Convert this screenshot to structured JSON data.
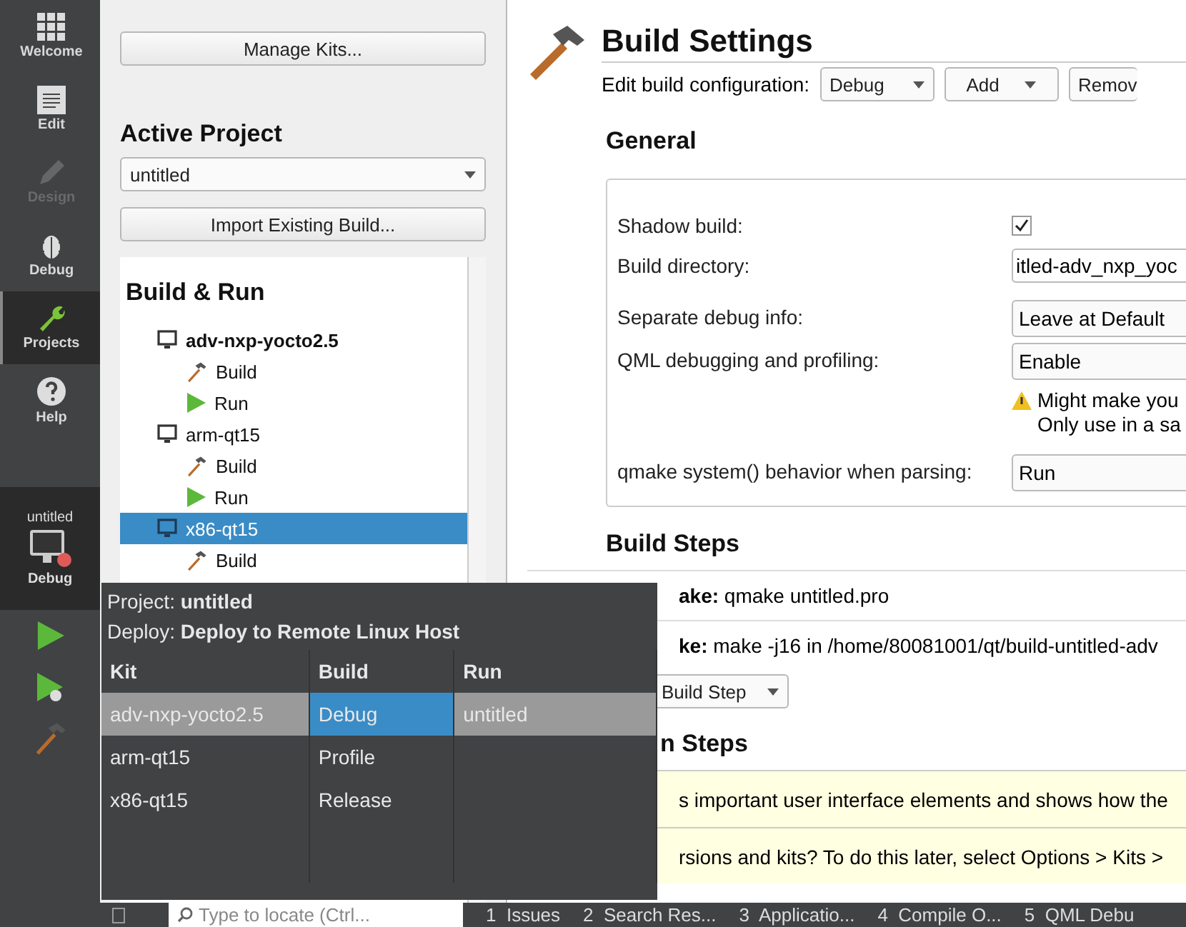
{
  "mode_bar": {
    "modes": [
      {
        "label": "Welcome",
        "kind": "welcome",
        "selected": false,
        "disabled": false
      },
      {
        "label": "Edit",
        "kind": "edit",
        "selected": false,
        "disabled": false
      },
      {
        "label": "Design",
        "kind": "design",
        "selected": false,
        "disabled": true
      },
      {
        "label": "Debug",
        "kind": "debug",
        "selected": false,
        "disabled": false
      },
      {
        "label": "Projects",
        "kind": "projects",
        "selected": true,
        "disabled": false
      },
      {
        "label": "Help",
        "kind": "help",
        "selected": false,
        "disabled": false
      }
    ],
    "target": {
      "project": "untitled",
      "config": "Debug"
    }
  },
  "projects_panel": {
    "manage_kits": "Manage Kits...",
    "active_project_heading": "Active Project",
    "project": "untitled",
    "import_button": "Import Existing Build...",
    "build_run_heading": "Build & Run",
    "tree": [
      {
        "label": "adv-nxp-yocto2.5",
        "active": true,
        "selected": false,
        "children": [
          {
            "label": "Build",
            "kind": "build"
          },
          {
            "label": "Run",
            "kind": "run"
          }
        ]
      },
      {
        "label": "arm-qt15",
        "active": false,
        "selected": false,
        "children": [
          {
            "label": "Build",
            "kind": "build"
          },
          {
            "label": "Run",
            "kind": "run"
          }
        ]
      },
      {
        "label": "x86-qt15",
        "active": false,
        "selected": true,
        "children": [
          {
            "label": "Build",
            "kind": "build"
          }
        ]
      }
    ]
  },
  "build_settings": {
    "title": "Build Settings",
    "config_label": "Edit build configuration:",
    "config": "Debug",
    "add": "Add",
    "remove": "Remov",
    "general_heading": "General",
    "shadow_build": {
      "label": "Shadow build:",
      "checked": true
    },
    "build_directory": {
      "label": "Build directory:",
      "value": "itled-adv_nxp_yoc"
    },
    "separate_debug": {
      "label": "Separate debug info:",
      "value": "Leave at Default"
    },
    "qml_debugging": {
      "label": "QML debugging and profiling:",
      "value": "Enable",
      "warning": [
        "Might make you",
        "Only use in a sa"
      ]
    },
    "qmake_system": {
      "label": "qmake system() behavior when parsing:",
      "value": "Run"
    },
    "build_steps_heading": "Build Steps",
    "steps": [
      {
        "name": "ake:",
        "command": "qmake untitled.pro"
      },
      {
        "name": "ke:",
        "command": "make -j16 in /home/80081001/qt/build-untitled-adv"
      }
    ],
    "add_step": "Build Step",
    "clean_heading": "n Steps",
    "notices": [
      "s important user interface elements and shows how the",
      "rsions and kits? To do this later, select Options > Kits >"
    ]
  },
  "target_popup": {
    "project_label": "Project:",
    "project": "untitled",
    "deploy_label": "Deploy:",
    "deploy": "Deploy to Remote Linux Host",
    "columns": [
      {
        "heading": "Kit",
        "items": [
          {
            "label": "adv-nxp-yocto2.5",
            "selected": true
          },
          {
            "label": "arm-qt15",
            "selected": false
          },
          {
            "label": "x86-qt15",
            "selected": false
          }
        ]
      },
      {
        "heading": "Build",
        "items": [
          {
            "label": "Debug",
            "selected": true
          },
          {
            "label": "Profile",
            "selected": false
          },
          {
            "label": "Release",
            "selected": false
          }
        ]
      },
      {
        "heading": "Run",
        "items": [
          {
            "label": "untitled",
            "selected": true
          }
        ]
      }
    ]
  },
  "status_bar": {
    "locator_placeholder": "Type to locate (Ctrl...",
    "panes": [
      "1  Issues",
      "2  Search Res...",
      "3  Applicatio...",
      "4  Compile O...",
      "5  QML Debu"
    ]
  }
}
